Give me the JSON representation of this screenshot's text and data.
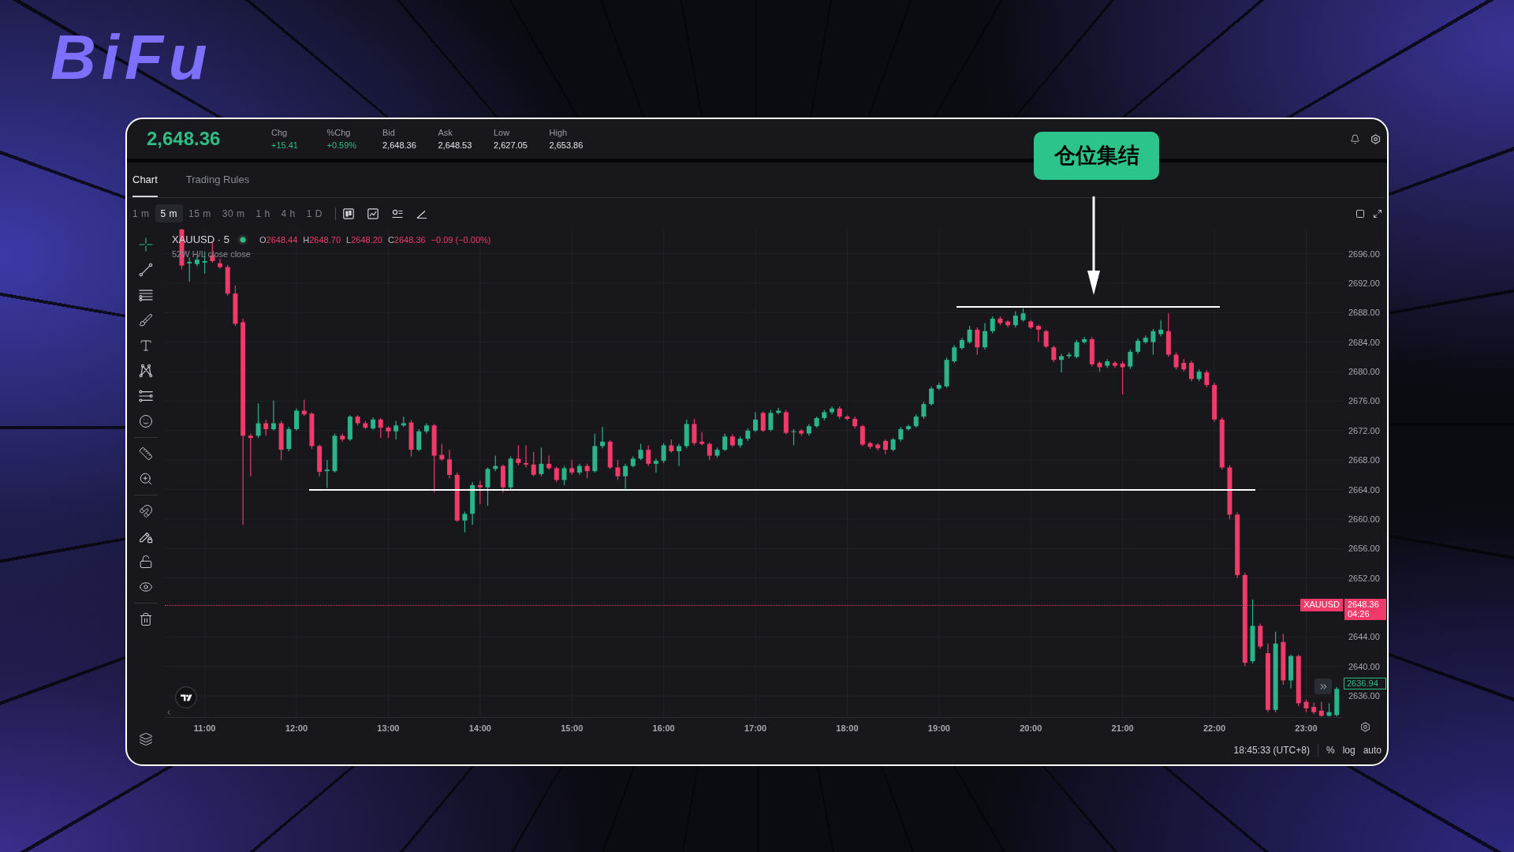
{
  "brand": {
    "text": "BiFu"
  },
  "header": {
    "price": "2,648.36",
    "stats": [
      {
        "label": "Chg",
        "value": "+15.41",
        "color": "#2ebd85"
      },
      {
        "label": "%Chg",
        "value": "+0.59%",
        "color": "#2ebd85"
      },
      {
        "label": "Bid",
        "value": "2,648.36",
        "color": "#e4e4ea"
      },
      {
        "label": "Ask",
        "value": "2,648.53",
        "color": "#e4e4ea"
      },
      {
        "label": "Low",
        "value": "2,627.05",
        "color": "#e4e4ea"
      },
      {
        "label": "High",
        "value": "2,653.86",
        "color": "#e4e4ea"
      }
    ]
  },
  "tabs": [
    {
      "label": "Chart",
      "selected": true
    },
    {
      "label": "Trading Rules",
      "selected": false
    }
  ],
  "intervals": [
    {
      "label": "1 m",
      "selected": false
    },
    {
      "label": "5 m",
      "selected": true
    },
    {
      "label": "15 m",
      "selected": false
    },
    {
      "label": "30 m",
      "selected": false
    },
    {
      "label": "1 h",
      "selected": false
    },
    {
      "label": "4 h",
      "selected": false
    },
    {
      "label": "1 D",
      "selected": false
    }
  ],
  "drawing_tools": [
    {
      "tools": [
        {
          "kind": "crosshair",
          "selected": true
        },
        {
          "kind": "trend_line",
          "selected": false
        },
        {
          "kind": "fib_lines",
          "selected": false
        },
        {
          "kind": "brush",
          "selected": false
        },
        {
          "kind": "text",
          "selected": false
        },
        {
          "kind": "pattern",
          "selected": false
        },
        {
          "kind": "projection",
          "selected": false
        },
        {
          "kind": "emoji",
          "selected": false
        }
      ]
    },
    {
      "tools": [
        {
          "kind": "ruler",
          "selected": false
        },
        {
          "kind": "zoom",
          "selected": false
        }
      ]
    },
    {
      "tools": [
        {
          "kind": "magnet",
          "selected": false
        },
        {
          "kind": "lock_drawings",
          "selected": false
        },
        {
          "kind": "unlock",
          "selected": false
        },
        {
          "kind": "hide",
          "selected": false
        }
      ]
    },
    {
      "tools": [
        {
          "kind": "trash",
          "selected": false
        }
      ]
    }
  ],
  "legend": {
    "symbol": "XAUUSD · 5",
    "live": true,
    "ohlc": [
      {
        "label": "O",
        "value": "2648.44"
      },
      {
        "label": "H",
        "value": "2648.70"
      },
      {
        "label": "L",
        "value": "2648.20"
      },
      {
        "label": "C",
        "value": "2648.36"
      }
    ],
    "change": "−0.09 (−0.00%)",
    "indicator": "52W H/L close close"
  },
  "chart": {
    "chart_data": {
      "type": "candlestick",
      "x": [
        645,
        650,
        655,
        660,
        665,
        670,
        675,
        680,
        685,
        690,
        695,
        700,
        705,
        710,
        715,
        720,
        725,
        730,
        735,
        740,
        745,
        750,
        755,
        760,
        765,
        770,
        775,
        780,
        785,
        790,
        795,
        800,
        805,
        810,
        815,
        820,
        825,
        830,
        835,
        840,
        845,
        850,
        855,
        860,
        865,
        870,
        875,
        880,
        885,
        890,
        895,
        900,
        905,
        910,
        915,
        920,
        925,
        930,
        935,
        940,
        945,
        950,
        955,
        960,
        965,
        970,
        975,
        980,
        985,
        990,
        995,
        1000,
        1005,
        1010,
        1015,
        1020,
        1025,
        1030,
        1035,
        1040,
        1045,
        1050,
        1055,
        1060,
        1065,
        1070,
        1075,
        1080,
        1085,
        1090,
        1095,
        1100,
        1105,
        1110,
        1115,
        1120,
        1125,
        1130,
        1135,
        1140,
        1145,
        1150,
        1155,
        1160,
        1165,
        1170,
        1175,
        1180,
        1185,
        1190,
        1195,
        1200,
        1205,
        1210,
        1215,
        1220,
        1225,
        1230,
        1235,
        1240,
        1245,
        1250,
        1255,
        1260,
        1265,
        1270,
        1275,
        1280,
        1285,
        1290,
        1295,
        1300,
        1305,
        1310,
        1315,
        1320,
        1325,
        1330,
        1335,
        1340,
        1345,
        1350,
        1355,
        1360,
        1365,
        1370,
        1375,
        1380,
        1385,
        1390,
        1395,
        1400
      ],
      "ohlc": [
        [
          2699.3,
          2699.5,
          2693.9,
          2694.4
        ],
        [
          2694.7,
          2695.5,
          2692.2,
          2694.9
        ],
        [
          2694.6,
          2695.6,
          2694.3,
          2695.2
        ],
        [
          2694.8,
          2696.3,
          2693.3,
          2695.0
        ],
        [
          2695.8,
          2697.5,
          2694.8,
          2695.0
        ],
        [
          2694.7,
          2695.3,
          2694.0,
          2694.2
        ],
        [
          2694.2,
          2694.5,
          2690.3,
          2690.6
        ],
        [
          2690.6,
          2691.7,
          2686.2,
          2686.5
        ],
        [
          2686.7,
          2687.2,
          2659.2,
          2671.3
        ],
        [
          2671.3,
          2671.6,
          2665.8,
          2671.0
        ],
        [
          2671.3,
          2675.7,
          2671.0,
          2673.0
        ],
        [
          2673.0,
          2673.5,
          2671.3,
          2672.2
        ],
        [
          2672.2,
          2676.1,
          2672.0,
          2673.0
        ],
        [
          2673.0,
          2673.3,
          2668.0,
          2669.4
        ],
        [
          2669.5,
          2672.5,
          2669.2,
          2672.2
        ],
        [
          2672.2,
          2675.0,
          2672.0,
          2674.7
        ],
        [
          2674.7,
          2676.2,
          2674.0,
          2674.2
        ],
        [
          2674.3,
          2674.5,
          2669.5,
          2669.9
        ],
        [
          2669.9,
          2670.1,
          2665.8,
          2666.4
        ],
        [
          2666.5,
          2668.0,
          2664.2,
          2666.7
        ],
        [
          2666.5,
          2671.6,
          2666.3,
          2671.3
        ],
        [
          2671.3,
          2671.6,
          2670.5,
          2670.8
        ],
        [
          2670.8,
          2674.1,
          2670.6,
          2673.9
        ],
        [
          2673.9,
          2674.1,
          2672.7,
          2673.0
        ],
        [
          2673.0,
          2673.3,
          2672.2,
          2672.4
        ],
        [
          2672.3,
          2673.8,
          2672.1,
          2673.5
        ],
        [
          2673.5,
          2673.7,
          2671.0,
          2672.4
        ],
        [
          2672.4,
          2672.6,
          2671.0,
          2671.9
        ],
        [
          2671.9,
          2673.3,
          2670.8,
          2672.7
        ],
        [
          2672.7,
          2673.9,
          2672.5,
          2673.0
        ],
        [
          2673.1,
          2673.4,
          2668.5,
          2669.4
        ],
        [
          2669.4,
          2672.2,
          2669.2,
          2671.9
        ],
        [
          2671.9,
          2673.0,
          2671.6,
          2672.7
        ],
        [
          2672.7,
          2672.9,
          2663.6,
          2668.6
        ],
        [
          2668.7,
          2670.2,
          2667.9,
          2668.1
        ],
        [
          2668.1,
          2669.4,
          2665.5,
          2666.0
        ],
        [
          2666.0,
          2666.3,
          2659.6,
          2659.8
        ],
        [
          2659.8,
          2661.0,
          2658.2,
          2660.7
        ],
        [
          2660.7,
          2665.0,
          2659.2,
          2664.6
        ],
        [
          2664.6,
          2665.2,
          2662.0,
          2664.3
        ],
        [
          2664.3,
          2667.0,
          2661.8,
          2666.8
        ],
        [
          2666.8,
          2668.6,
          2666.5,
          2667.2
        ],
        [
          2667.2,
          2667.4,
          2663.6,
          2664.3
        ],
        [
          2664.3,
          2668.5,
          2664.0,
          2668.2
        ],
        [
          2668.2,
          2670.0,
          2667.3,
          2667.6
        ],
        [
          2667.6,
          2670.0,
          2667.0,
          2667.4
        ],
        [
          2667.4,
          2669.1,
          2665.8,
          2666.0
        ],
        [
          2666.1,
          2669.7,
          2665.8,
          2667.5
        ],
        [
          2667.5,
          2668.6,
          2666.7,
          2666.9
        ],
        [
          2666.9,
          2667.1,
          2665.0,
          2665.3
        ],
        [
          2665.3,
          2667.2,
          2664.6,
          2666.9
        ],
        [
          2666.9,
          2668.0,
          2666.0,
          2666.3
        ],
        [
          2666.3,
          2667.5,
          2666.0,
          2667.2
        ],
        [
          2667.2,
          2667.5,
          2665.5,
          2666.5
        ],
        [
          2666.5,
          2671.6,
          2666.3,
          2669.9
        ],
        [
          2669.9,
          2672.5,
          2669.6,
          2670.5
        ],
        [
          2670.5,
          2670.7,
          2666.8,
          2667.0
        ],
        [
          2667.0,
          2668.0,
          2665.3,
          2665.8
        ],
        [
          2665.8,
          2667.5,
          2664.1,
          2667.2
        ],
        [
          2667.2,
          2668.5,
          2667.0,
          2668.2
        ],
        [
          2668.2,
          2670.2,
          2668.0,
          2669.4
        ],
        [
          2669.4,
          2670.0,
          2667.2,
          2667.5
        ],
        [
          2667.5,
          2668.2,
          2666.3,
          2667.9
        ],
        [
          2667.9,
          2670.3,
          2667.6,
          2670.0
        ],
        [
          2670.0,
          2670.8,
          2669.0,
          2669.2
        ],
        [
          2669.2,
          2670.2,
          2667.2,
          2669.9
        ],
        [
          2669.9,
          2673.5,
          2669.6,
          2672.9
        ],
        [
          2672.9,
          2673.6,
          2670.0,
          2670.3
        ],
        [
          2670.5,
          2671.8,
          2670.0,
          2670.2
        ],
        [
          2670.2,
          2670.4,
          2668.0,
          2668.6
        ],
        [
          2668.6,
          2669.7,
          2668.3,
          2669.4
        ],
        [
          2669.4,
          2671.6,
          2669.2,
          2671.2
        ],
        [
          2671.2,
          2671.5,
          2669.8,
          2670.0
        ],
        [
          2670.0,
          2671.2,
          2669.7,
          2670.9
        ],
        [
          2670.9,
          2672.3,
          2670.6,
          2672.0
        ],
        [
          2672.0,
          2674.5,
          2671.8,
          2673.5
        ],
        [
          2674.4,
          2674.6,
          2671.8,
          2672.0
        ],
        [
          2672.1,
          2674.8,
          2671.9,
          2674.4
        ],
        [
          2674.4,
          2675.1,
          2674.2,
          2674.7
        ],
        [
          2674.5,
          2674.8,
          2671.5,
          2671.7
        ],
        [
          2671.8,
          2672.2,
          2670.0,
          2671.9
        ],
        [
          2672.0,
          2672.2,
          2671.3,
          2671.6
        ],
        [
          2671.6,
          2672.9,
          2671.3,
          2672.6
        ],
        [
          2672.6,
          2673.9,
          2672.4,
          2673.7
        ],
        [
          2673.7,
          2674.8,
          2673.4,
          2674.5
        ],
        [
          2674.5,
          2675.3,
          2674.2,
          2675.0
        ],
        [
          2675.0,
          2675.3,
          2673.6,
          2673.9
        ],
        [
          2673.9,
          2674.1,
          2673.4,
          2673.6
        ],
        [
          2673.6,
          2673.9,
          2672.3,
          2672.6
        ],
        [
          2672.6,
          2672.8,
          2669.9,
          2670.1
        ],
        [
          2670.3,
          2670.5,
          2669.5,
          2669.8
        ],
        [
          2670.1,
          2670.3,
          2669.3,
          2669.6
        ],
        [
          2670.6,
          2670.8,
          2668.8,
          2669.4
        ],
        [
          2669.4,
          2671.0,
          2669.2,
          2670.8
        ],
        [
          2670.8,
          2672.5,
          2670.5,
          2672.2
        ],
        [
          2672.2,
          2672.8,
          2672.0,
          2672.6
        ],
        [
          2672.6,
          2674.2,
          2672.4,
          2673.9
        ],
        [
          2673.9,
          2675.9,
          2673.6,
          2675.6
        ],
        [
          2675.6,
          2678.0,
          2675.4,
          2677.7
        ],
        [
          2677.7,
          2678.5,
          2677.5,
          2678.2
        ],
        [
          2678.0,
          2681.9,
          2677.8,
          2681.6
        ],
        [
          2681.4,
          2683.6,
          2681.2,
          2683.3
        ],
        [
          2683.2,
          2684.6,
          2683.0,
          2684.3
        ],
        [
          2684.0,
          2686.2,
          2683.8,
          2685.7
        ],
        [
          2685.7,
          2686.0,
          2682.3,
          2683.3
        ],
        [
          2683.3,
          2686.6,
          2683.0,
          2685.5
        ],
        [
          2685.5,
          2687.5,
          2685.2,
          2687.2
        ],
        [
          2687.2,
          2687.5,
          2686.3,
          2686.6
        ],
        [
          2686.8,
          2687.0,
          2686.0,
          2686.3
        ],
        [
          2686.3,
          2688.2,
          2686.0,
          2687.6
        ],
        [
          2687.0,
          2688.6,
          2686.8,
          2687.9
        ],
        [
          2686.8,
          2687.0,
          2685.8,
          2686.0
        ],
        [
          2686.2,
          2686.4,
          2684.0,
          2685.7
        ],
        [
          2685.5,
          2685.7,
          2683.2,
          2683.4
        ],
        [
          2683.3,
          2683.5,
          2681.3,
          2681.6
        ],
        [
          2681.6,
          2682.4,
          2679.9,
          2682.1
        ],
        [
          2682.1,
          2682.6,
          2681.8,
          2682.3
        ],
        [
          2682.0,
          2684.3,
          2681.8,
          2684.0
        ],
        [
          2684.0,
          2684.7,
          2683.8,
          2684.4
        ],
        [
          2684.4,
          2684.7,
          2680.7,
          2681.0
        ],
        [
          2681.2,
          2681.4,
          2680.0,
          2680.6
        ],
        [
          2680.8,
          2681.7,
          2680.5,
          2681.4
        ],
        [
          2681.2,
          2681.4,
          2680.5,
          2680.8
        ],
        [
          2681.1,
          2681.4,
          2676.9,
          2680.6
        ],
        [
          2680.7,
          2683.0,
          2680.4,
          2682.7
        ],
        [
          2682.7,
          2684.5,
          2682.4,
          2684.2
        ],
        [
          2684.0,
          2684.9,
          2683.8,
          2684.6
        ],
        [
          2684.0,
          2685.8,
          2682.3,
          2685.5
        ],
        [
          2685.1,
          2687.0,
          2684.8,
          2685.7
        ],
        [
          2685.5,
          2687.9,
          2682.0,
          2682.3
        ],
        [
          2682.3,
          2682.6,
          2680.3,
          2680.6
        ],
        [
          2681.2,
          2681.7,
          2680.0,
          2680.3
        ],
        [
          2681.2,
          2681.5,
          2678.7,
          2679.0
        ],
        [
          2679.0,
          2680.3,
          2678.7,
          2680.0
        ],
        [
          2679.9,
          2680.2,
          2677.9,
          2678.2
        ],
        [
          2678.2,
          2678.5,
          2673.2,
          2673.5
        ],
        [
          2673.5,
          2673.8,
          2666.7,
          2667.0
        ],
        [
          2667.0,
          2667.3,
          2660.0,
          2660.6
        ],
        [
          2660.6,
          2660.9,
          2652.0,
          2652.4
        ],
        [
          2652.4,
          2652.7,
          2640.0,
          2640.5
        ],
        [
          2640.7,
          2649.1,
          2640.4,
          2645.5
        ],
        [
          2645.5,
          2645.8,
          2642.4,
          2642.7
        ],
        [
          2641.8,
          2643.1,
          2633.8,
          2634.1
        ],
        [
          2634.1,
          2644.7,
          2633.8,
          2643.1
        ],
        [
          2643.3,
          2644.4,
          2637.5,
          2638.1
        ],
        [
          2638.1,
          2641.6,
          2637.0,
          2641.4
        ],
        [
          2641.4,
          2641.6,
          2634.6,
          2635.0
        ],
        [
          2635.2,
          2635.5,
          2633.8,
          2634.3
        ],
        [
          2634.5,
          2635.1,
          2633.5,
          2633.8
        ],
        [
          2634.0,
          2635.2,
          2633.2,
          2633.3
        ],
        [
          2633.3,
          2635.0,
          2633.2,
          2633.8
        ],
        [
          2633.4,
          2637.2,
          2633.2,
          2636.94
        ]
      ],
      "xlim": [
        633.9,
        1404.0
      ],
      "ylim": [
        2633.12,
        2699.39
      ],
      "xticks": [
        {
          "value": 660,
          "label": "11:00"
        },
        {
          "value": 720,
          "label": "12:00"
        },
        {
          "value": 780,
          "label": "13:00"
        },
        {
          "value": 840,
          "label": "14:00"
        },
        {
          "value": 900,
          "label": "15:00"
        },
        {
          "value": 960,
          "label": "16:00"
        },
        {
          "value": 1020,
          "label": "17:00"
        },
        {
          "value": 1080,
          "label": "18:00"
        },
        {
          "value": 1140,
          "label": "19:00"
        },
        {
          "value": 1200,
          "label": "20:00"
        },
        {
          "value": 1260,
          "label": "21:00"
        },
        {
          "value": 1320,
          "label": "22:00"
        },
        {
          "value": 1380,
          "label": "23:00"
        }
      ],
      "yticks": [
        {
          "value": 2696,
          "label": "2696.00"
        },
        {
          "value": 2692,
          "label": "2692.00"
        },
        {
          "value": 2688,
          "label": "2688.00"
        },
        {
          "value": 2684,
          "label": "2684.00"
        },
        {
          "value": 2680,
          "label": "2680.00"
        },
        {
          "value": 2676,
          "label": "2676.00"
        },
        {
          "value": 2672,
          "label": "2672.00"
        },
        {
          "value": 2668,
          "label": "2668.00"
        },
        {
          "value": 2664,
          "label": "2664.00"
        },
        {
          "value": 2660,
          "label": "2660.00"
        },
        {
          "value": 2656,
          "label": "2656.00"
        },
        {
          "value": 2652,
          "label": "2652.00"
        },
        {
          "value": 2644,
          "label": "2644.00"
        },
        {
          "value": 2640,
          "label": "2640.00"
        },
        {
          "value": 2636,
          "label": "2636.00"
        }
      ],
      "grid": true,
      "ref_lines": [
        {
          "axis": "y",
          "value": 2648.36,
          "color": "#ef3a6a"
        }
      ]
    }
  },
  "price_tags": {
    "symbol": "XAUUSD",
    "price": "2648.36",
    "countdown": "04:26",
    "last": "2636.94"
  },
  "status_bar": {
    "clock": "18:45:33 (UTC+8)",
    "scale_options": [
      "%",
      "log",
      "auto"
    ]
  },
  "annotation": {
    "callout": "仓位集结"
  }
}
